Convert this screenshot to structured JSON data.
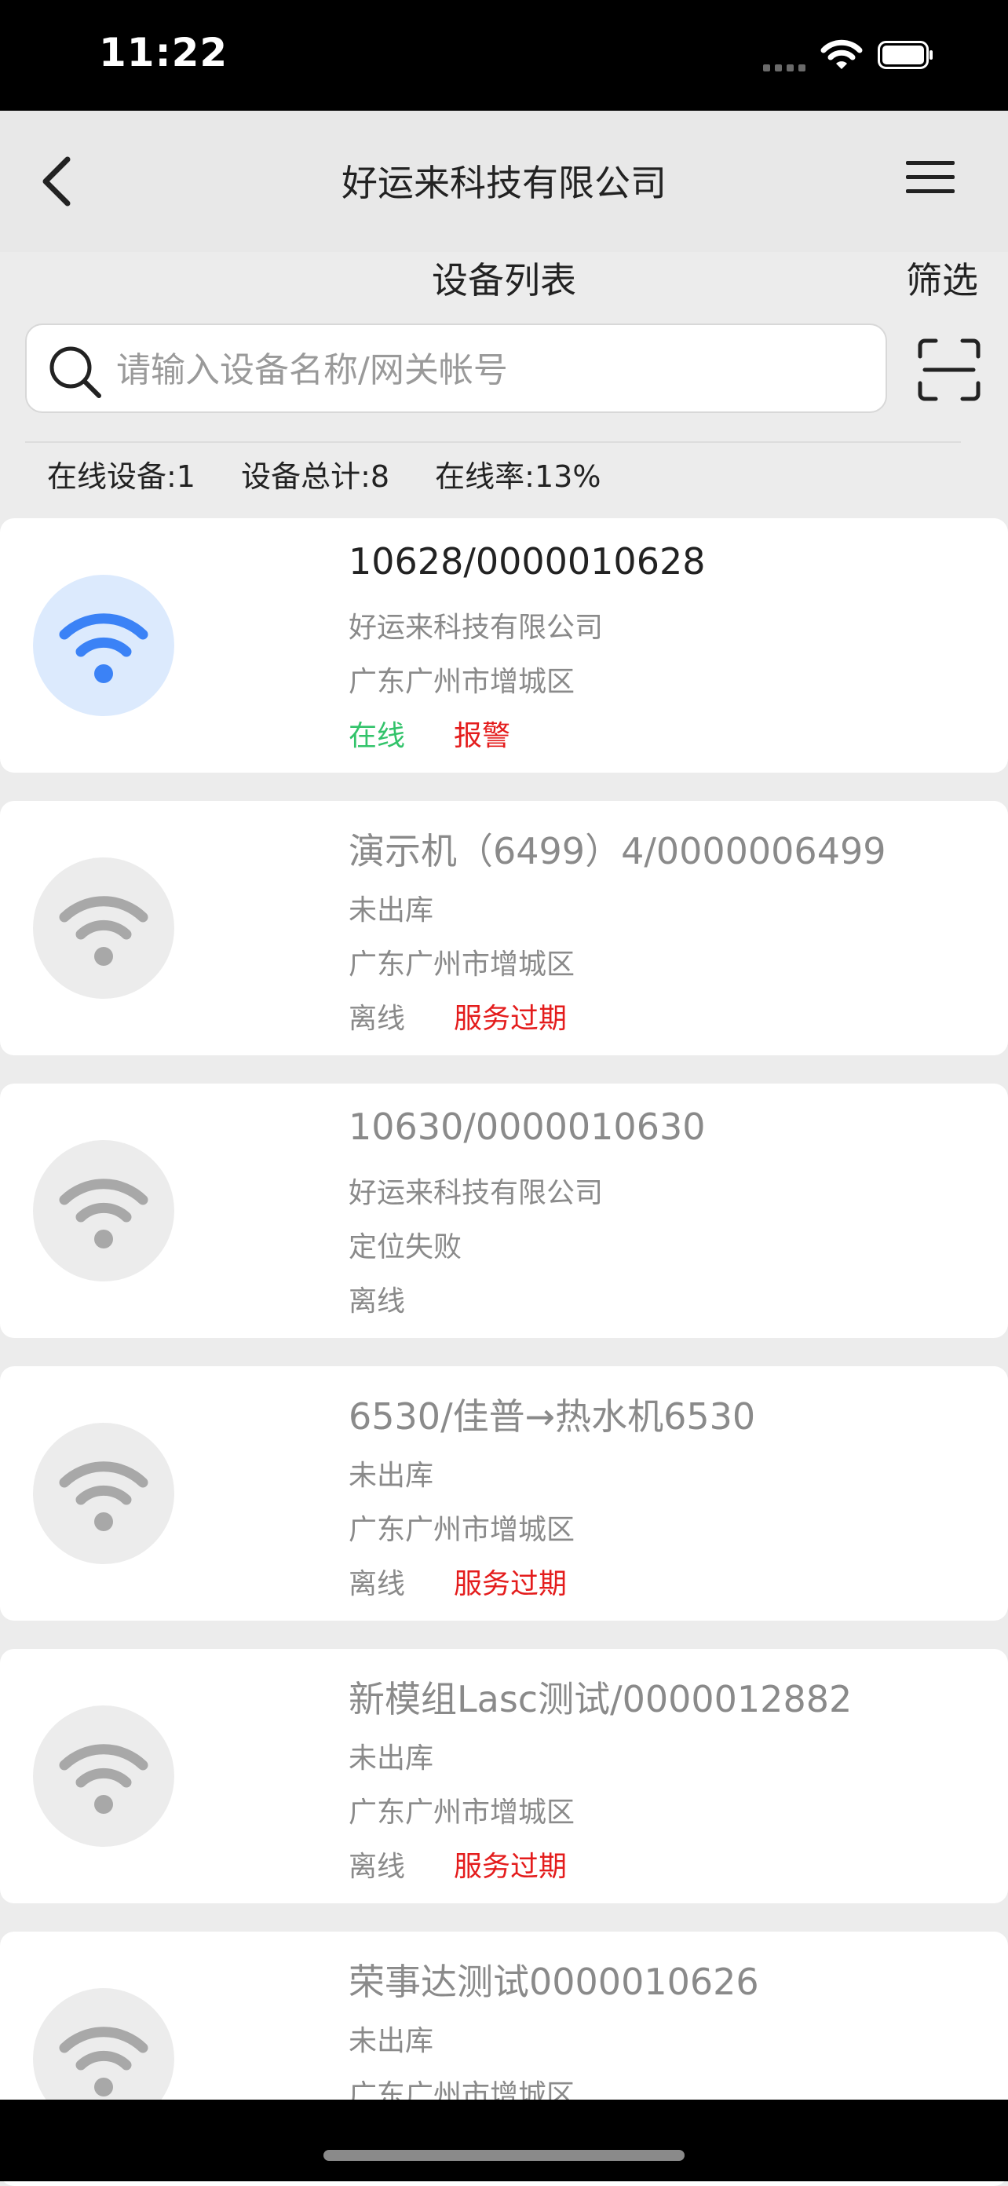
{
  "status_bar": {
    "time": "11:22"
  },
  "nav": {
    "title": "好运来科技有限公司"
  },
  "subheader": {
    "title": "设备列表",
    "filter_label": "筛选"
  },
  "search": {
    "placeholder": "请输入设备名称/网关帐号",
    "value": ""
  },
  "stats": {
    "online": "在线设备:1",
    "total": "设备总计:8",
    "rate": "在线率:13%"
  },
  "devices": [
    {
      "name": "10628/0000010628",
      "line1": "好运来科技有限公司",
      "line2": "广东广州市增城区",
      "status": "在线",
      "tag": "报警",
      "online": true
    },
    {
      "name": "演示机（6499）4/0000006499",
      "line1": "未出库",
      "line2": "广东广州市增城区",
      "status": "离线",
      "tag": "服务过期",
      "online": false
    },
    {
      "name": "10630/0000010630",
      "line1": "好运来科技有限公司",
      "line2": "定位失败",
      "status": "离线",
      "tag": "",
      "online": false
    },
    {
      "name": "6530/佳普→热水机6530",
      "line1": "未出库",
      "line2": "广东广州市增城区",
      "status": "离线",
      "tag": "服务过期",
      "online": false
    },
    {
      "name": "新模组Lasc测试/0000012882",
      "line1": "未出库",
      "line2": "广东广州市增城区",
      "status": "离线",
      "tag": "服务过期",
      "online": false
    },
    {
      "name": "荣事达测试0000010626",
      "line1": "未出库",
      "line2": "广东广州市增城区",
      "status": "",
      "tag": "",
      "online": false
    }
  ],
  "colors": {
    "online_green": "#32c36a",
    "alert_red": "#e41c1c",
    "wifi_blue": "#3b82f6",
    "wifi_gray": "#a8a8a8"
  },
  "icons": {
    "wifi": "wifi-icon",
    "back": "chevron-left-icon",
    "menu": "hamburger-menu-icon",
    "search": "search-icon",
    "scan": "scan-icon"
  }
}
